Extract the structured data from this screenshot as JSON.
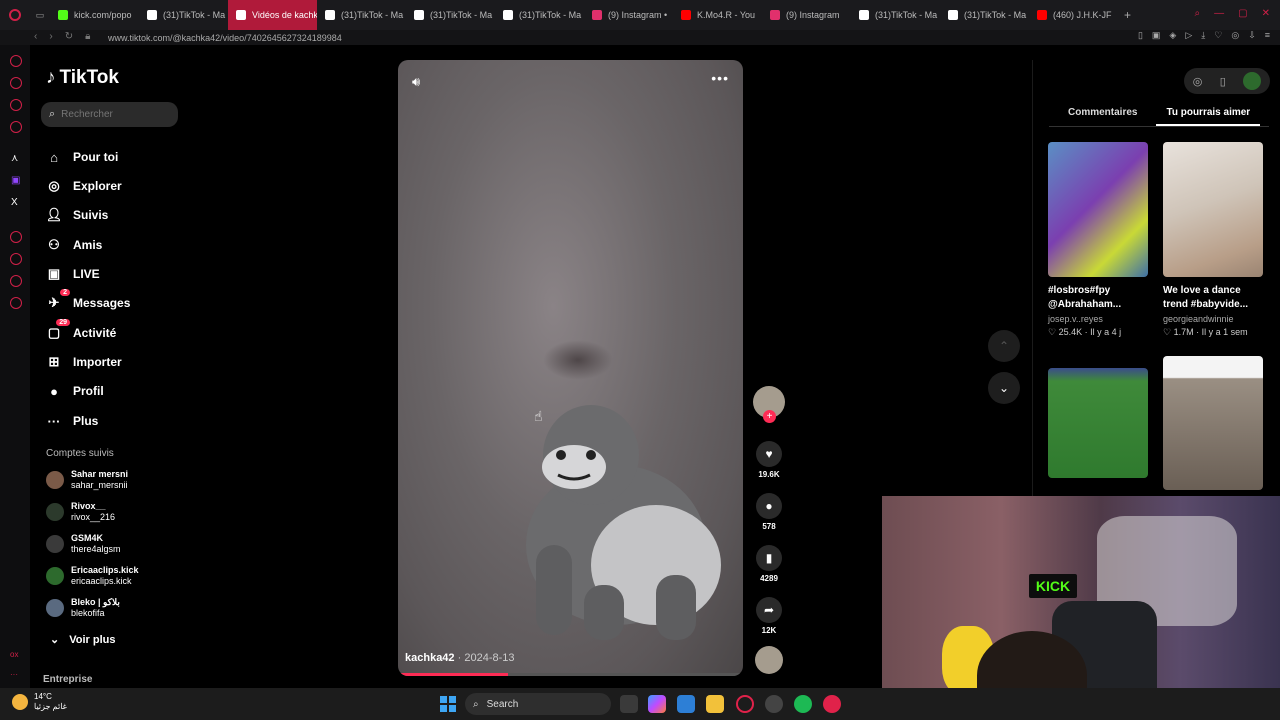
{
  "browser": {
    "tabs": [
      {
        "label": "kick.com/popo",
        "color": "#53fc18"
      },
      {
        "label": "(31)TikTok - Ma",
        "color": "#ffffff"
      },
      {
        "label": "Vidéos de kachka ❤ (@k",
        "color": "#ffffff",
        "active": true
      },
      {
        "label": "(31)TikTok - Ma",
        "color": "#ffffff"
      },
      {
        "label": "(31)TikTok - Ma",
        "color": "#ffffff"
      },
      {
        "label": "(31)TikTok - Ma",
        "color": "#ffffff"
      },
      {
        "label": "(9) Instagram •",
        "color": "#e1306c"
      },
      {
        "label": "K.Mo4.R - You",
        "color": "#ff0000"
      },
      {
        "label": "(9) Instagram",
        "color": "#e1306c"
      },
      {
        "label": "(31)TikTok - Ma",
        "color": "#ffffff"
      },
      {
        "label": "(31)TikTok - Ma",
        "color": "#ffffff"
      },
      {
        "label": "(460) J.H.K-JF",
        "color": "#ff0000"
      }
    ],
    "url": "www.tiktok.com/@kachka42/video/7402645627324189984"
  },
  "sidebar": {
    "logo": "TikTok",
    "search_placeholder": "Rechercher",
    "nav": [
      {
        "label": "Pour toi",
        "icon": "home-icon"
      },
      {
        "label": "Explorer",
        "icon": "compass-icon"
      },
      {
        "label": "Suivis",
        "icon": "following-icon"
      },
      {
        "label": "Amis",
        "icon": "friends-icon"
      },
      {
        "label": "LIVE",
        "icon": "live-icon"
      },
      {
        "label": "Messages",
        "icon": "messages-icon",
        "badge": "2"
      },
      {
        "label": "Activité",
        "icon": "activity-icon",
        "badge": "29"
      },
      {
        "label": "Importer",
        "icon": "upload-icon"
      },
      {
        "label": "Profil",
        "icon": "profile-icon"
      },
      {
        "label": "Plus",
        "icon": "more-icon"
      }
    ],
    "following_title": "Comptes suivis",
    "accounts": [
      {
        "name": "Sahar mersni",
        "handle": "sahar_mersnii"
      },
      {
        "name": "Rivox__",
        "handle": "rivox__216"
      },
      {
        "name": "GSM4K",
        "handle": "there4algsm"
      },
      {
        "name": "Ericaaclips.kick",
        "handle": "ericaaclips.kick"
      },
      {
        "name": "Bleko | بلاكو",
        "handle": "blekofifa"
      }
    ],
    "see_more": "Voir plus",
    "footer": "Entreprise"
  },
  "video": {
    "username": "kachka42",
    "date": "2024-8-13",
    "progress": 0.32
  },
  "actions": {
    "likes": "19.6K",
    "comments": "578",
    "saves": "4289",
    "shares": "12K"
  },
  "right_panel": {
    "tabs": [
      "Commentaires",
      "Tu pourrais aimer"
    ],
    "cards": [
      {
        "title": "#losbros#fpy @Abrahaham...",
        "author": "josep.v..reyes",
        "likes": "25.4K",
        "age": "Il y a 4 j"
      },
      {
        "title": "We love a dance trend #babyvide...",
        "author": "georgieandwinnie",
        "likes": "1.7M",
        "age": "Il y a 1 sem"
      }
    ]
  },
  "webcam": {
    "sign": "KICK"
  },
  "taskbar": {
    "temp": "14°C",
    "weather_label": "غائم جزئيا",
    "search": "Search"
  }
}
